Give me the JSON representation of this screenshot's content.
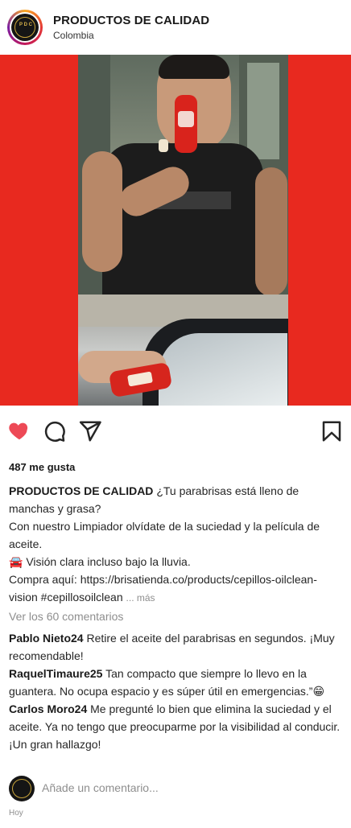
{
  "header": {
    "account_name": "PRODUCTOS DE CALIDAD",
    "location": "Colombia",
    "avatar_text": "PRODUCTOS DE CALIDAD"
  },
  "media": {
    "background_color": "#e8291f"
  },
  "actions": {
    "like_icon": "heart-filled-icon",
    "comment_icon": "comment-icon",
    "share_icon": "send-icon",
    "save_icon": "bookmark-icon",
    "like_color": "#ed4956"
  },
  "likes": {
    "text": "487 me gusta"
  },
  "caption": {
    "user": "PRODUCTOS DE CALIDAD",
    "line1": "¿Tu parabrisas está lleno de manchas y grasa?",
    "line2": "Con nuestro Limpiador olvídate de la suciedad y la película de aceite.",
    "line3_emoji": "🚘",
    "line3": "Visión clara incluso bajo la lluvia.",
    "line4": "Compra aquí: https://brisatienda.co/products/cepillos-oilclean-vision #cepillosoilclean",
    "more": "... más"
  },
  "view_comments": "Ver los 60 comentarios",
  "comments": [
    {
      "user": "Pablo Nieto24",
      "text": "Retire el aceite del parabrisas en segundos. ¡Muy recomendable!"
    },
    {
      "user": "RaquelTimaure25",
      "text": "Tan compacto que siempre lo llevo en la guantera. No ocupa espacio y es súper útil en emergencias.”😁"
    },
    {
      "user": "Carlos Moro24",
      "text": "Me pregunté lo bien que elimina la suciedad y el aceite. Ya no tengo que preocuparme por la visibilidad al conducir. ¡Un gran hallazgo!"
    }
  ],
  "add_comment": {
    "placeholder": "Añade un comentario..."
  },
  "timestamp": "Hoy"
}
